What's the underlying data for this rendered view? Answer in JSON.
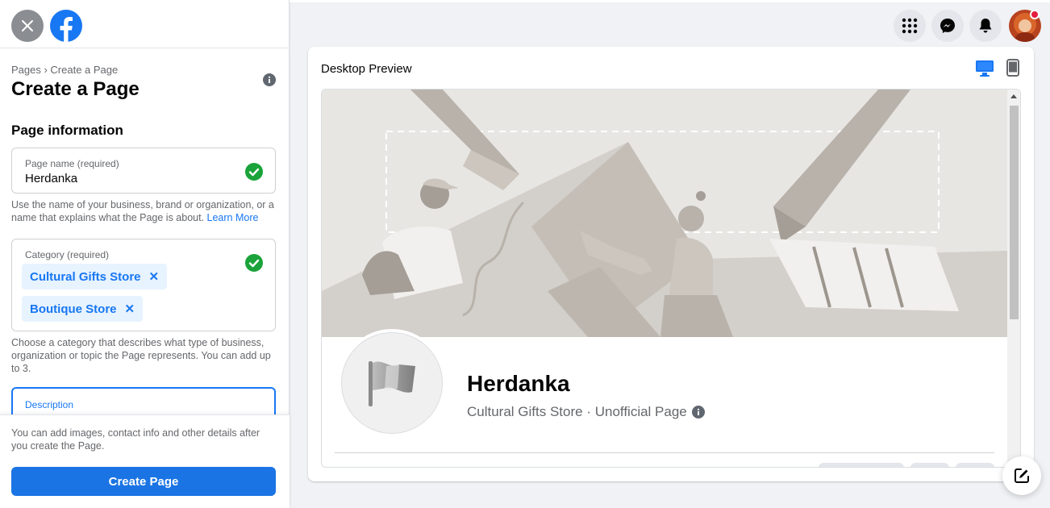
{
  "left_panel": {
    "breadcrumb": "Pages › Create a Page",
    "title": "Create a Page",
    "section_title": "Page information",
    "page_name": {
      "label": "Page name (required)",
      "value": "Herdanka",
      "help": "Use the name of your business, brand or organization, or a name that explains what the Page is about.",
      "learn_more": "Learn More"
    },
    "category": {
      "label": "Category (required)",
      "chips": [
        "Cultural Gifts Store",
        "Boutique Store"
      ],
      "remove_glyph": "✕",
      "help": "Choose a category that describes what type of business, organization or topic the Page represents. You can add up to 3."
    },
    "description": {
      "label": "Description"
    },
    "bottom_help": "You can add images, contact info and other details after you create the Page.",
    "create_button": "Create Page"
  },
  "preview": {
    "title": "Desktop Preview",
    "page_name": "Herdanka",
    "subtitle": "Cultural Gifts Store · Unofficial Page"
  },
  "colors": {
    "accent": "#1877f2",
    "check": "#1aa33a",
    "notification": "#e41e3f"
  },
  "icons": [
    "close-icon",
    "facebook-logo",
    "info-icon",
    "check-icon",
    "menu-grid-icon",
    "messenger-icon",
    "bell-icon",
    "desktop-icon",
    "mobile-icon",
    "flag-icon",
    "edit-icon"
  ]
}
